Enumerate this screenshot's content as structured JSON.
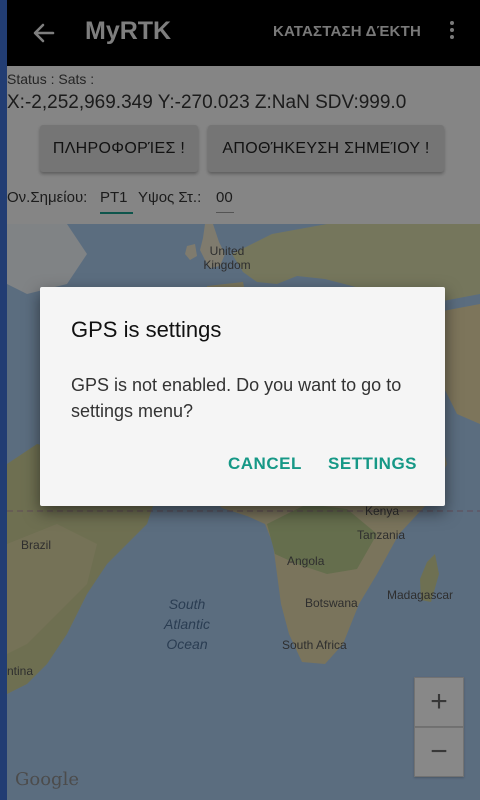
{
  "toolbar": {
    "title": "MyRTK",
    "action": "ΚΑΤΑΣΤΑΣΗ ΔΈΚΤΗ"
  },
  "status": {
    "text": "Status : Sats :",
    "coords": "X:-2,252,969.349 Y:-270.023 Z:NaN SDV:999.0"
  },
  "buttons": {
    "info": "ΠΛΗΡΟΦΟΡΊΕΣ !",
    "save": "ΑΠΟΘΉΚΕΥΣΗ ΣΗΜΕΊΟΥ !"
  },
  "fields": {
    "point_name_label": "Ον.Σημείου:",
    "point_name_value": "PT1",
    "height_label": "Υψος Στ.:",
    "height_value": "00"
  },
  "map": {
    "labels": {
      "uk": "United Kingdom",
      "kenya": "Kenya",
      "tanzania": "Tanzania",
      "brazil": "Brazil",
      "angola": "Angola",
      "madagascar": "Madagascar",
      "botswana": "Botswana",
      "south_africa": "South Africa",
      "argentina": "ntina",
      "ocean": "South Atlantic Ocean",
      "ocean_l1": "South",
      "ocean_l2": "Atlantic",
      "ocean_l3": "Ocean"
    },
    "zoom_in": "+",
    "zoom_out": "−",
    "attribution": "Google"
  },
  "dialog": {
    "title": "GPS is settings",
    "message": "GPS is not enabled. Do you want to go to settings menu?",
    "cancel": "CANCEL",
    "settings": "SETTINGS"
  },
  "colors": {
    "accent": "#169886",
    "field_underline": "#1a9b8a"
  }
}
